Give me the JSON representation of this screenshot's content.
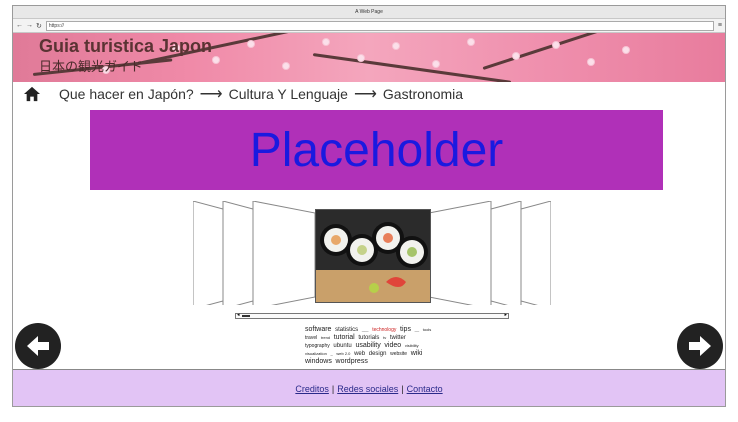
{
  "browser": {
    "title": "A Web Page",
    "nav": {
      "back": "←",
      "forward": "→",
      "reload": "↻"
    },
    "url": "https://",
    "menu_icon": "≡"
  },
  "header": {
    "title": "Guia turistica Japon",
    "subtitle": "日本の観光ガイド",
    "background_color": "#f08aa8"
  },
  "breadcrumb": {
    "home_icon": "home-icon",
    "items": [
      "Que hacer en Japón?",
      "Cultura Y Lenguaje",
      "Gastronomia"
    ],
    "separator": "⟶"
  },
  "banner": {
    "text": "Placeholder",
    "background_color": "#b030b8",
    "text_color": "#1a1ae0"
  },
  "carousel": {
    "center_image": "sushi-roll-image"
  },
  "scrollbar": {
    "left": "◂",
    "right": "▸"
  },
  "tagcloud": {
    "tags": [
      "software",
      "statistics",
      "___",
      "technology",
      "tips",
      "__",
      "tools",
      "travel",
      "trend",
      "tutorial",
      "tutorials",
      "tv",
      "twitter",
      "typography",
      "ubuntu",
      "usability",
      "video",
      "visibility",
      "visualization",
      "_",
      "web 2.0",
      "web",
      "design",
      "website",
      "wiki",
      "windows",
      "wordpress"
    ]
  },
  "nav_buttons": {
    "prev_icon": "left-arrow-icon",
    "next_icon": "right-arrow-icon"
  },
  "footer": {
    "links": [
      "Creditos",
      "Redes sociales",
      "Contacto"
    ],
    "separator": "|",
    "background_color": "#e2c4f5"
  }
}
